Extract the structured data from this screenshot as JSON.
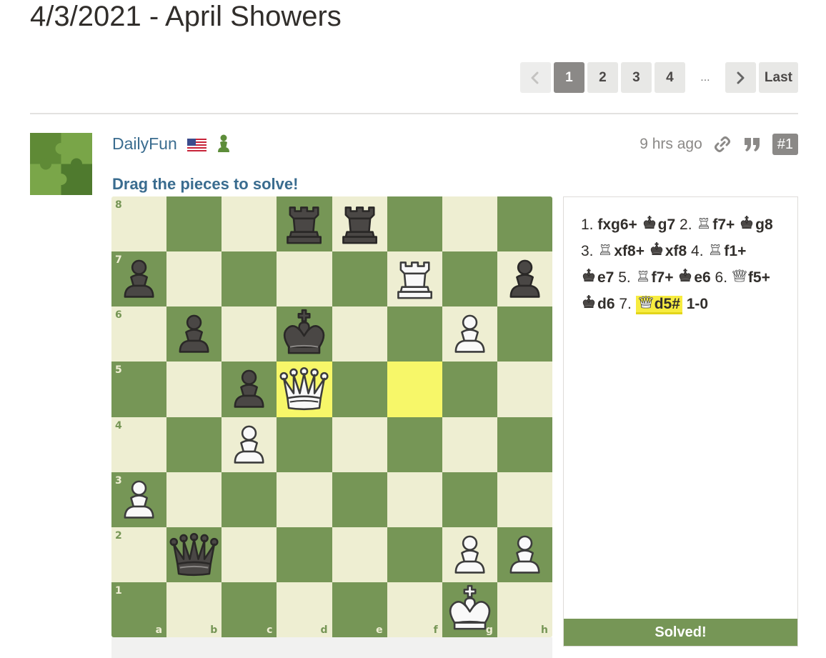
{
  "page": {
    "title": "4/3/2021 - April Showers"
  },
  "pagination": {
    "prev_icon": "chevron-left-icon",
    "pages": [
      "1",
      "2",
      "3",
      "4"
    ],
    "current": "1",
    "ellipsis": "...",
    "next_icon": "chevron-right-icon",
    "last_label": "Last"
  },
  "post": {
    "username": "DailyFun",
    "flag_icon": "us-flag-icon",
    "badge_icon": "pawn-icon",
    "time_ago": "9 hrs ago",
    "post_number": "#1",
    "prompt": "Drag the pieces to solve!"
  },
  "board": {
    "ranks": [
      "8",
      "7",
      "6",
      "5",
      "4",
      "3",
      "2",
      "1"
    ],
    "files": [
      "a",
      "b",
      "c",
      "d",
      "e",
      "f",
      "g",
      "h"
    ],
    "position": {
      "d8": "bR",
      "e8": "bR",
      "a7": "bP",
      "f7": "wR",
      "h7": "bP",
      "b6": "bP",
      "d6": "bK",
      "g6": "wP",
      "c5": "bP",
      "d5": "wQ",
      "c4": "wP",
      "a3": "wP",
      "b2": "bQ",
      "g2": "wP",
      "h2": "wP",
      "g1": "wK"
    },
    "highlighted": [
      "d5",
      "f5"
    ],
    "colors": {
      "light": "#eeeed2",
      "dark": "#769656",
      "highlight": "#f7f769"
    }
  },
  "moves": {
    "items": [
      {
        "num": "1.",
        "san": "fxg6+"
      },
      {
        "fig": "bK",
        "san": "g7"
      },
      {
        "num": "2.",
        "fig": "wR",
        "san": "f7+"
      },
      {
        "fig": "bK",
        "san": "g8"
      },
      {
        "num": "3.",
        "fig": "wR",
        "san": "xf8+"
      },
      {
        "fig": "bK",
        "san": "xf8"
      },
      {
        "num": "4.",
        "fig": "wR",
        "san": "f1+"
      },
      {
        "fig": "bK",
        "san": "e7"
      },
      {
        "num": "5.",
        "fig": "wR",
        "san": "f7+"
      },
      {
        "fig": "bK",
        "san": "e6"
      },
      {
        "num": "6.",
        "fig": "wQ",
        "san": "f5+"
      },
      {
        "fig": "bK",
        "san": "d6"
      },
      {
        "num": "7.",
        "fig": "wQ",
        "san": "d5#",
        "final": true
      }
    ],
    "result": "1-0",
    "status": "Solved!"
  }
}
